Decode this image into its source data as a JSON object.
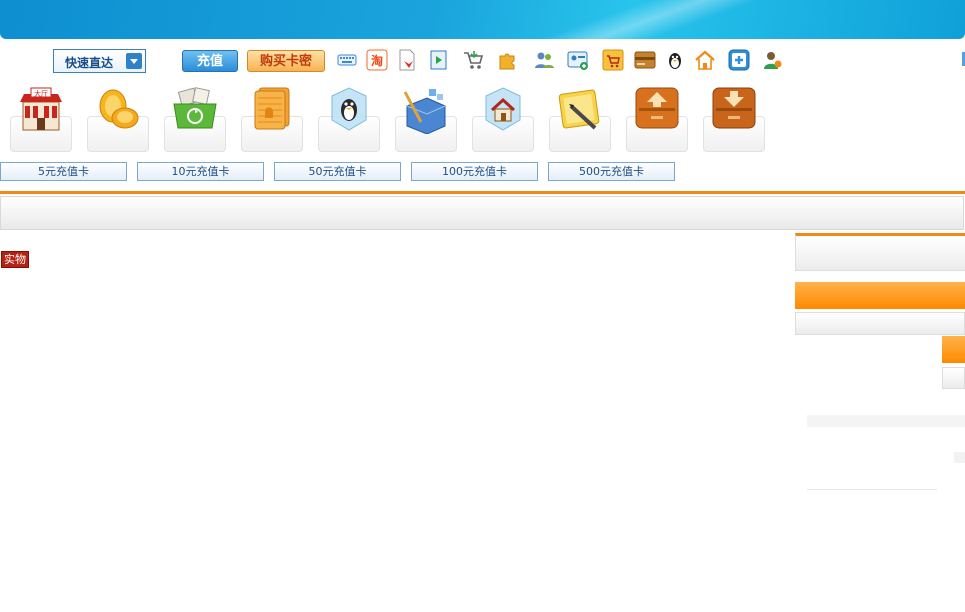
{
  "header": {
    "quick_nav_label": "快速直达",
    "recharge_label": "充值",
    "buy_card_label": "购买卡密"
  },
  "toolbar_icons": [
    "keyboard-icon",
    "taobao-icon",
    "document-icon",
    "door-exit-icon",
    "cart-icon",
    "puzzle-icon",
    "users-icon",
    "id-card-icon",
    "shop-icon",
    "wallet-icon",
    "qq-penguin-icon",
    "home-icon",
    "plus-icon",
    "user-icon"
  ],
  "big_icons": [
    {
      "name": "lobby-icon",
      "label": "大厅"
    },
    {
      "name": "coins-icon"
    },
    {
      "name": "recycle-icon"
    },
    {
      "name": "cards-icon"
    },
    {
      "name": "penguin-cube-icon"
    },
    {
      "name": "building-blocks-icon"
    },
    {
      "name": "house-cube-icon"
    },
    {
      "name": "notepad-pen-icon"
    },
    {
      "name": "upload-box-icon"
    },
    {
      "name": "download-box-icon"
    }
  ],
  "recharge_cards": [
    "5元充值卡",
    "10元充值卡",
    "50元充值卡",
    "100元充值卡",
    "500元充值卡"
  ],
  "main": {
    "tag_label": "实物"
  },
  "colors": {
    "banner": "#1aa4dc",
    "accent_orange": "#f08a14",
    "card_text": "#1f4f86"
  }
}
